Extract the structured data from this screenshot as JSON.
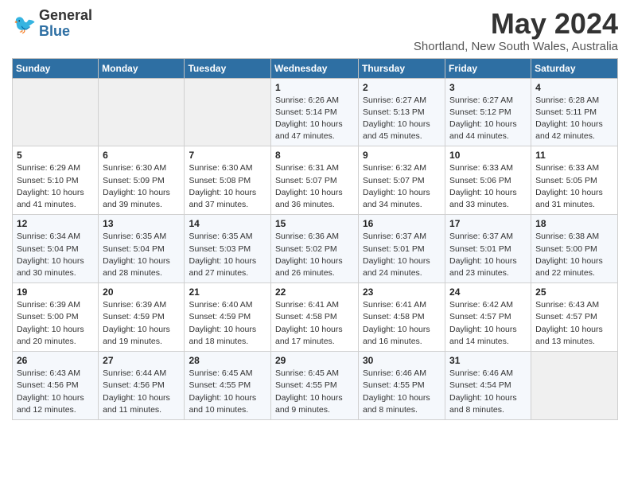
{
  "header": {
    "logo_general": "General",
    "logo_blue": "Blue",
    "title": "May 2024",
    "subtitle": "Shortland, New South Wales, Australia"
  },
  "calendar": {
    "days_of_week": [
      "Sunday",
      "Monday",
      "Tuesday",
      "Wednesday",
      "Thursday",
      "Friday",
      "Saturday"
    ],
    "weeks": [
      [
        {
          "day": "",
          "info": ""
        },
        {
          "day": "",
          "info": ""
        },
        {
          "day": "",
          "info": ""
        },
        {
          "day": "1",
          "info": "Sunrise: 6:26 AM\nSunset: 5:14 PM\nDaylight: 10 hours\nand 47 minutes."
        },
        {
          "day": "2",
          "info": "Sunrise: 6:27 AM\nSunset: 5:13 PM\nDaylight: 10 hours\nand 45 minutes."
        },
        {
          "day": "3",
          "info": "Sunrise: 6:27 AM\nSunset: 5:12 PM\nDaylight: 10 hours\nand 44 minutes."
        },
        {
          "day": "4",
          "info": "Sunrise: 6:28 AM\nSunset: 5:11 PM\nDaylight: 10 hours\nand 42 minutes."
        }
      ],
      [
        {
          "day": "5",
          "info": "Sunrise: 6:29 AM\nSunset: 5:10 PM\nDaylight: 10 hours\nand 41 minutes."
        },
        {
          "day": "6",
          "info": "Sunrise: 6:30 AM\nSunset: 5:09 PM\nDaylight: 10 hours\nand 39 minutes."
        },
        {
          "day": "7",
          "info": "Sunrise: 6:30 AM\nSunset: 5:08 PM\nDaylight: 10 hours\nand 37 minutes."
        },
        {
          "day": "8",
          "info": "Sunrise: 6:31 AM\nSunset: 5:07 PM\nDaylight: 10 hours\nand 36 minutes."
        },
        {
          "day": "9",
          "info": "Sunrise: 6:32 AM\nSunset: 5:07 PM\nDaylight: 10 hours\nand 34 minutes."
        },
        {
          "day": "10",
          "info": "Sunrise: 6:33 AM\nSunset: 5:06 PM\nDaylight: 10 hours\nand 33 minutes."
        },
        {
          "day": "11",
          "info": "Sunrise: 6:33 AM\nSunset: 5:05 PM\nDaylight: 10 hours\nand 31 minutes."
        }
      ],
      [
        {
          "day": "12",
          "info": "Sunrise: 6:34 AM\nSunset: 5:04 PM\nDaylight: 10 hours\nand 30 minutes."
        },
        {
          "day": "13",
          "info": "Sunrise: 6:35 AM\nSunset: 5:04 PM\nDaylight: 10 hours\nand 28 minutes."
        },
        {
          "day": "14",
          "info": "Sunrise: 6:35 AM\nSunset: 5:03 PM\nDaylight: 10 hours\nand 27 minutes."
        },
        {
          "day": "15",
          "info": "Sunrise: 6:36 AM\nSunset: 5:02 PM\nDaylight: 10 hours\nand 26 minutes."
        },
        {
          "day": "16",
          "info": "Sunrise: 6:37 AM\nSunset: 5:01 PM\nDaylight: 10 hours\nand 24 minutes."
        },
        {
          "day": "17",
          "info": "Sunrise: 6:37 AM\nSunset: 5:01 PM\nDaylight: 10 hours\nand 23 minutes."
        },
        {
          "day": "18",
          "info": "Sunrise: 6:38 AM\nSunset: 5:00 PM\nDaylight: 10 hours\nand 22 minutes."
        }
      ],
      [
        {
          "day": "19",
          "info": "Sunrise: 6:39 AM\nSunset: 5:00 PM\nDaylight: 10 hours\nand 20 minutes."
        },
        {
          "day": "20",
          "info": "Sunrise: 6:39 AM\nSunset: 4:59 PM\nDaylight: 10 hours\nand 19 minutes."
        },
        {
          "day": "21",
          "info": "Sunrise: 6:40 AM\nSunset: 4:59 PM\nDaylight: 10 hours\nand 18 minutes."
        },
        {
          "day": "22",
          "info": "Sunrise: 6:41 AM\nSunset: 4:58 PM\nDaylight: 10 hours\nand 17 minutes."
        },
        {
          "day": "23",
          "info": "Sunrise: 6:41 AM\nSunset: 4:58 PM\nDaylight: 10 hours\nand 16 minutes."
        },
        {
          "day": "24",
          "info": "Sunrise: 6:42 AM\nSunset: 4:57 PM\nDaylight: 10 hours\nand 14 minutes."
        },
        {
          "day": "25",
          "info": "Sunrise: 6:43 AM\nSunset: 4:57 PM\nDaylight: 10 hours\nand 13 minutes."
        }
      ],
      [
        {
          "day": "26",
          "info": "Sunrise: 6:43 AM\nSunset: 4:56 PM\nDaylight: 10 hours\nand 12 minutes."
        },
        {
          "day": "27",
          "info": "Sunrise: 6:44 AM\nSunset: 4:56 PM\nDaylight: 10 hours\nand 11 minutes."
        },
        {
          "day": "28",
          "info": "Sunrise: 6:45 AM\nSunset: 4:55 PM\nDaylight: 10 hours\nand 10 minutes."
        },
        {
          "day": "29",
          "info": "Sunrise: 6:45 AM\nSunset: 4:55 PM\nDaylight: 10 hours\nand 9 minutes."
        },
        {
          "day": "30",
          "info": "Sunrise: 6:46 AM\nSunset: 4:55 PM\nDaylight: 10 hours\nand 8 minutes."
        },
        {
          "day": "31",
          "info": "Sunrise: 6:46 AM\nSunset: 4:54 PM\nDaylight: 10 hours\nand 8 minutes."
        },
        {
          "day": "",
          "info": ""
        }
      ]
    ]
  }
}
